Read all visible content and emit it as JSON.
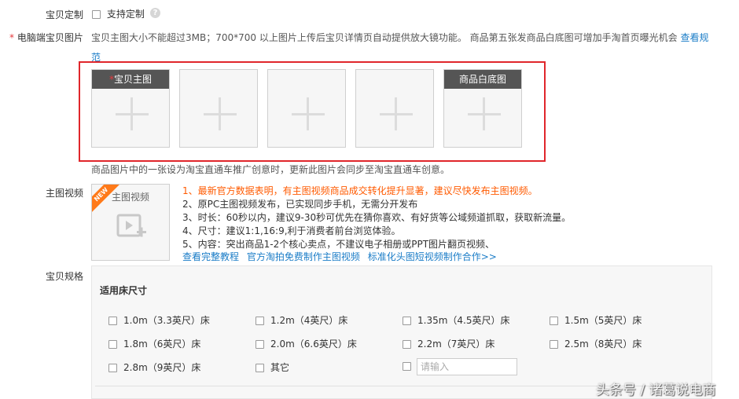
{
  "custom": {
    "label": "宝贝定制",
    "checkbox_label": "支持定制",
    "help_glyph": "?"
  },
  "pc_images": {
    "required_mark": "*",
    "label": "电脑端宝贝图片",
    "description": "宝贝主图大小不能超过3MB；700*700 以上图片上传后宝贝详情页自动提供放大镜功能。 商品第五张发商品白底图可增加手淘首页曝光机会",
    "link_part1": "查看规",
    "link_part2": "范",
    "slots": [
      {
        "tag_star": "*",
        "tag": "宝贝主图"
      },
      {
        "tag_star": "",
        "tag": ""
      },
      {
        "tag_star": "",
        "tag": ""
      },
      {
        "tag_star": "",
        "tag": ""
      },
      {
        "tag_star": "",
        "tag": "商品白底图"
      }
    ],
    "footer_note": "商品图片中的一张设为淘宝直通车推广创意时，更新此图片会同步至淘宝直通车创意。"
  },
  "video": {
    "label": "主图视频",
    "badge": "NEW",
    "box_title": "主图视频",
    "tips": [
      "1、最新官方数据表明，有主图视频商品成交转化提升显著，建议尽快发布主图视频。",
      "2、原PC主图视频发布，已实现同步手机，无需分开发布",
      "3、时长：60秒以内，建议9-30秒可优先在猜你喜欢、有好货等公域频道抓取，获取新流量。",
      "4、尺寸：建议1:1,16:9,利于消费者前台浏览体验。",
      "5、内容：突出商品1-2个核心卖点，不建议电子相册或PPT图片翻页视频、"
    ],
    "links": [
      "查看完整教程",
      "官方淘拍免费制作主图视频",
      "标准化头图短视频制作合作>>"
    ]
  },
  "spec": {
    "label": "宝贝规格",
    "group_title": "适用床尺寸",
    "options": [
      "1.0m（3.3英尺）床",
      "1.2m（4英尺）床",
      "1.35m（4.5英尺）床",
      "1.5m（5英尺）床",
      "1.8m（6英尺）床",
      "2.0m（6.6英尺）床",
      "2.2m（7英尺）床",
      "2.5m（8英尺）床",
      "2.8m（9英尺）床",
      "其它"
    ],
    "custom_input_placeholder": "请输入"
  },
  "watermark": "头条号 / 诸葛说电商",
  "colors": {
    "highlight_box": "#e0262b",
    "link": "#1a7cc7",
    "hot_tip": "#ff5a00",
    "new_badge": "#ff7a1a",
    "slot_tag_bg": "#555555"
  }
}
